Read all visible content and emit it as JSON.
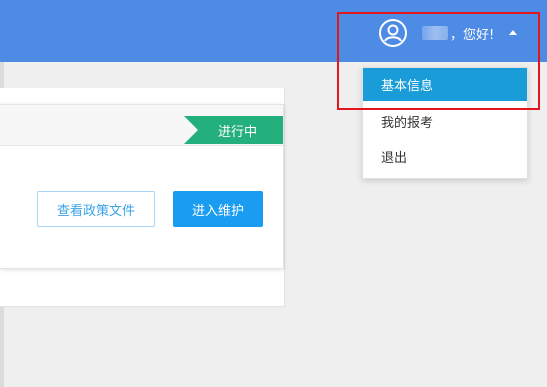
{
  "header": {
    "greeting": "，您好!",
    "avatar_icon": "user-circle-icon",
    "caret_icon": "caret-up-icon"
  },
  "card": {
    "status": "进行中",
    "view_policy_label": "查看政策文件",
    "enter_label": "进入维护"
  },
  "dropdown": {
    "items": [
      {
        "label": "基本信息",
        "active": true
      },
      {
        "label": "我的报考",
        "active": false
      },
      {
        "label": "退出",
        "active": false
      }
    ]
  },
  "colors": {
    "header": "#4d8be4",
    "status": "#23b07d",
    "primary": "#1a9cf0",
    "active_item": "#1a9cd8",
    "highlight": "#e3161c"
  }
}
